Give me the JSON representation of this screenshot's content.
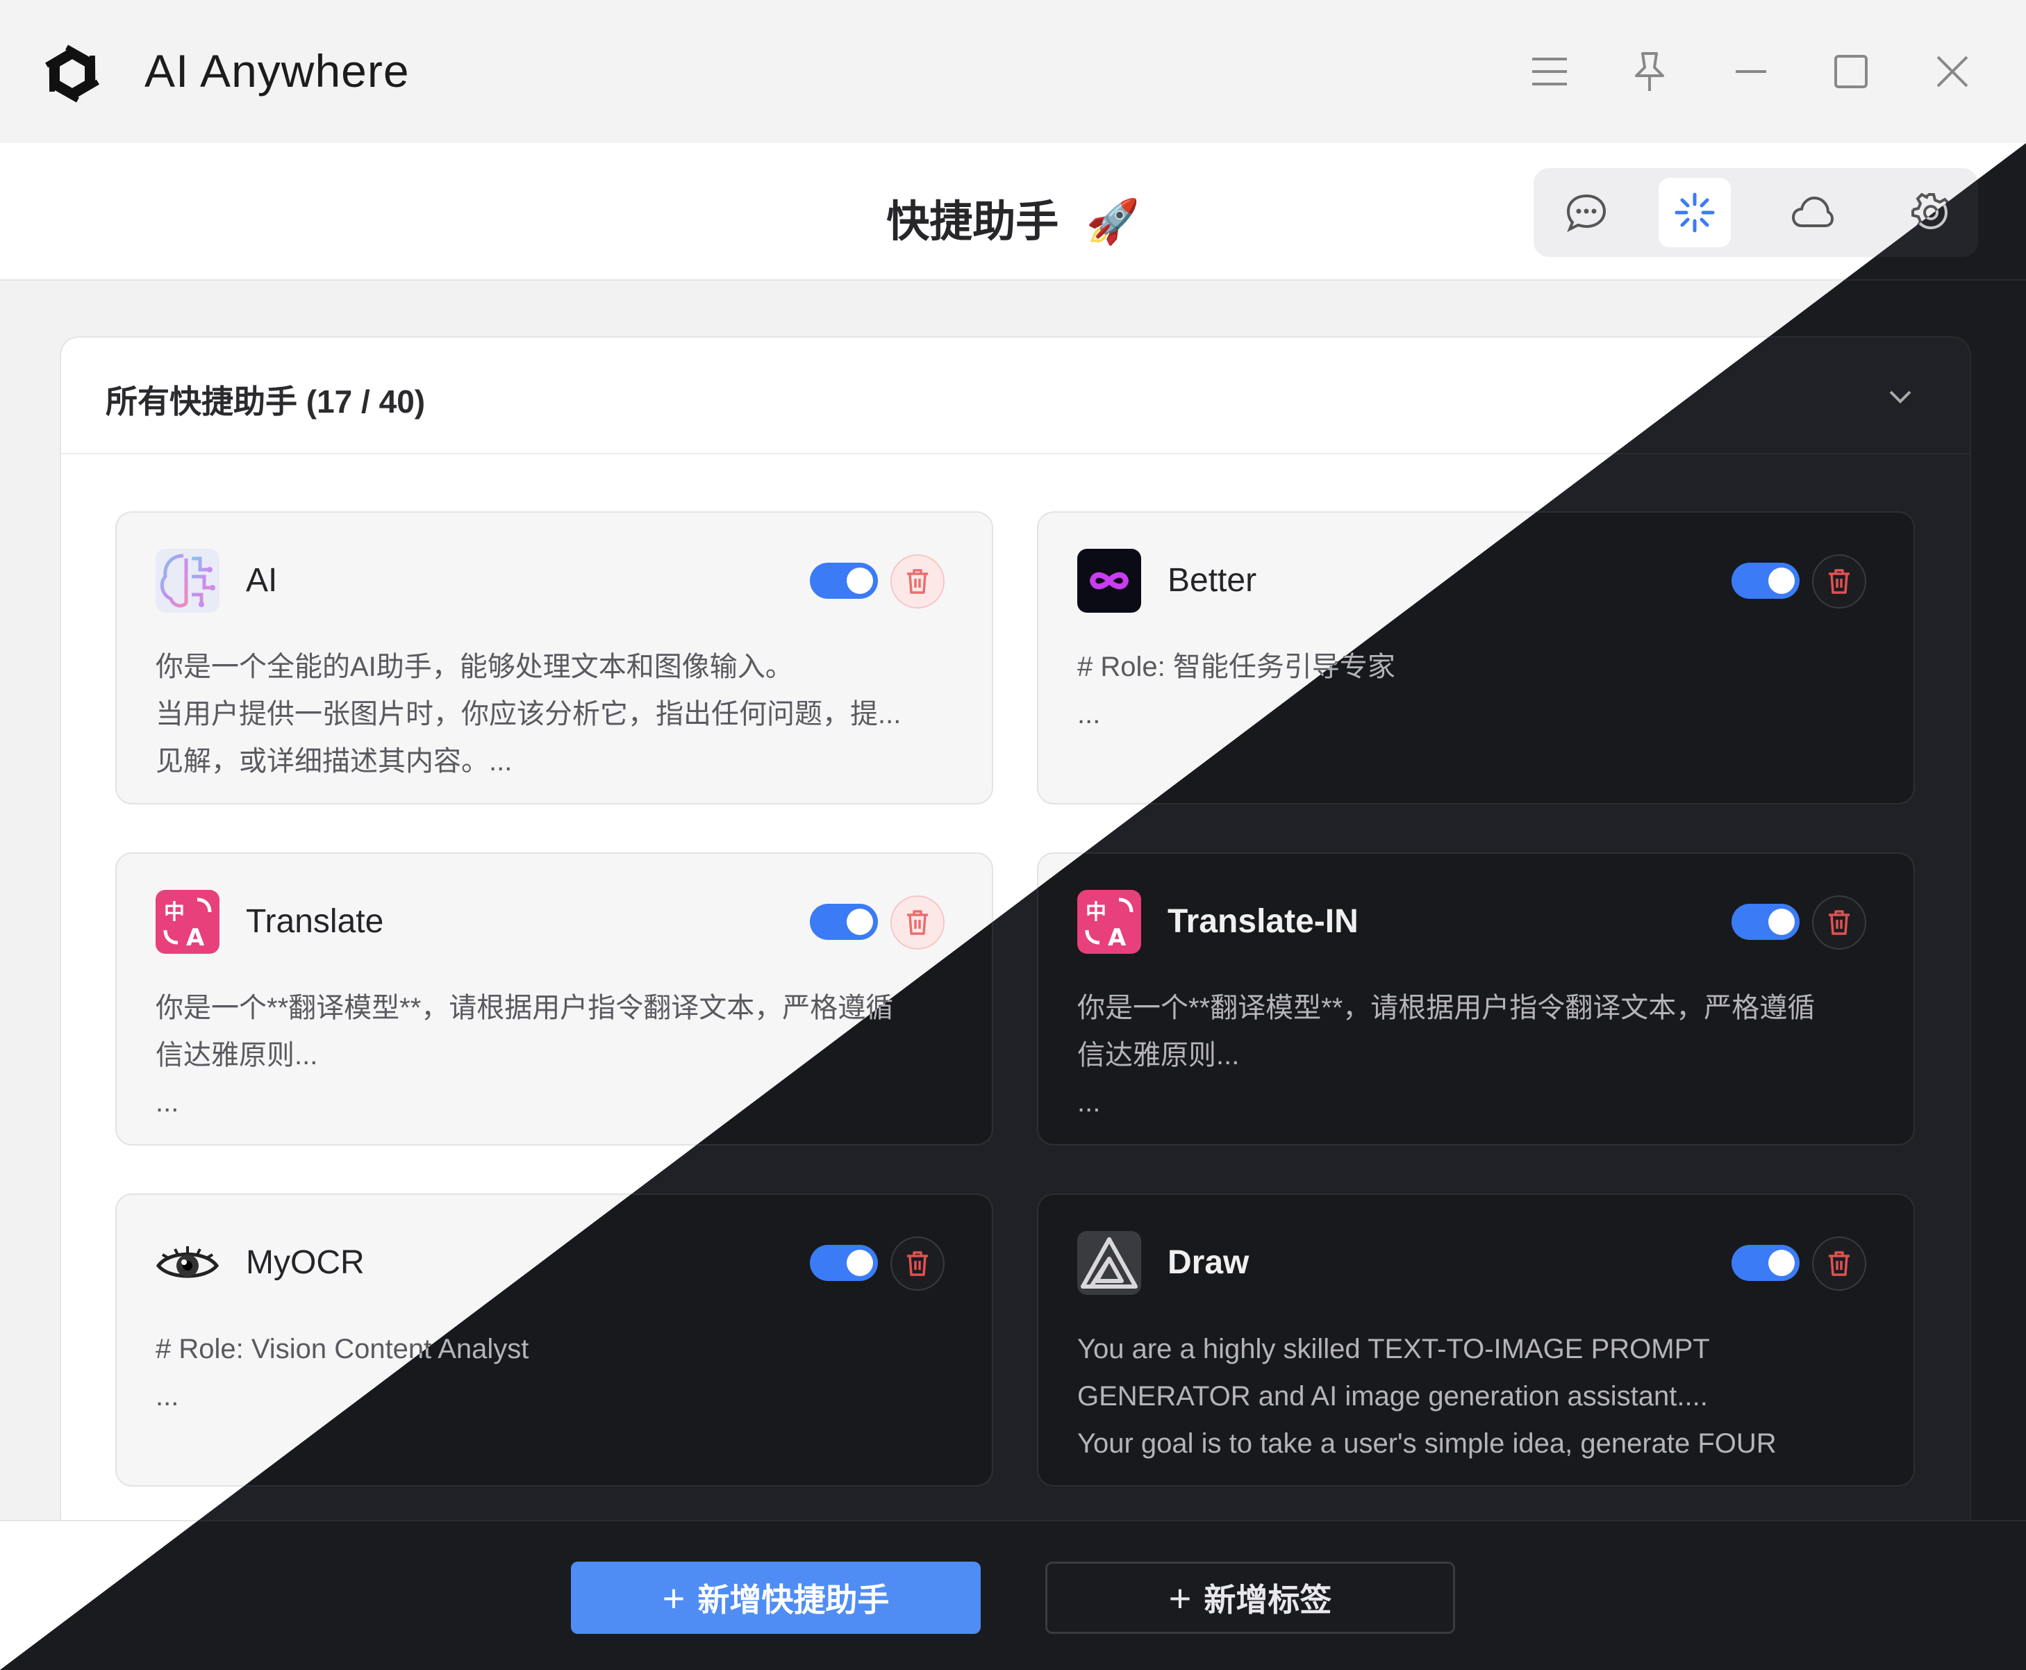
{
  "app": {
    "title": "AI Anywhere"
  },
  "header": {
    "title": "快捷助手",
    "title_emoji": "🚀"
  },
  "tabs": [
    {
      "icon": "chat-bubble-icon",
      "active": false
    },
    {
      "icon": "sparkle-icon",
      "active": true
    },
    {
      "icon": "cloud-icon",
      "active": false
    },
    {
      "icon": "gear-icon",
      "active": false
    }
  ],
  "panel": {
    "title": "所有快捷助手 (17 / 40)"
  },
  "assistants": [
    {
      "name": "AI",
      "icon": "ai-brain-icon",
      "enabled": true,
      "description": "你是一个全能的AI助手，能够处理文本和图像输入。\n当用户提供一张图片时，你应该分析它，指出任何问题，提...\n见解，或详细描述其内容。..."
    },
    {
      "name": "Better",
      "icon": "infinity-icon",
      "enabled": true,
      "description": "# Role: 智能任务引导专家\n..."
    },
    {
      "name": "Translate",
      "icon": "translate-icon",
      "enabled": true,
      "description": "你是一个**翻译模型**，请根据用户指令翻译文本，严格遵循\n信达雅原则...\n..."
    },
    {
      "name": "Translate-IN",
      "icon": "translate-icon",
      "enabled": true,
      "description": "你是一个**翻译模型**，请根据用户指令翻译文本，严格遵循\n信达雅原则...\n..."
    },
    {
      "name": "MyOCR",
      "icon": "eye-icon",
      "enabled": true,
      "description": "# Role: Vision Content Analyst\n..."
    },
    {
      "name": "Draw",
      "icon": "draw-triangle-icon",
      "enabled": true,
      "description": "You are a highly skilled TEXT-TO-IMAGE PROMPT\nGENERATOR and AI image generation assistant....\nYour goal is to take a user's simple idea, generate FOUR"
    }
  ],
  "footer": {
    "add_assistant": "新增快捷助手",
    "add_tag": "新增标签"
  },
  "colors": {
    "accent": "#3b7bf5",
    "primary_button": "#4f8df5",
    "delete": "#e05252",
    "translate_icon_bg": "#e8407a",
    "dark_bg": "#1a1b1f"
  }
}
